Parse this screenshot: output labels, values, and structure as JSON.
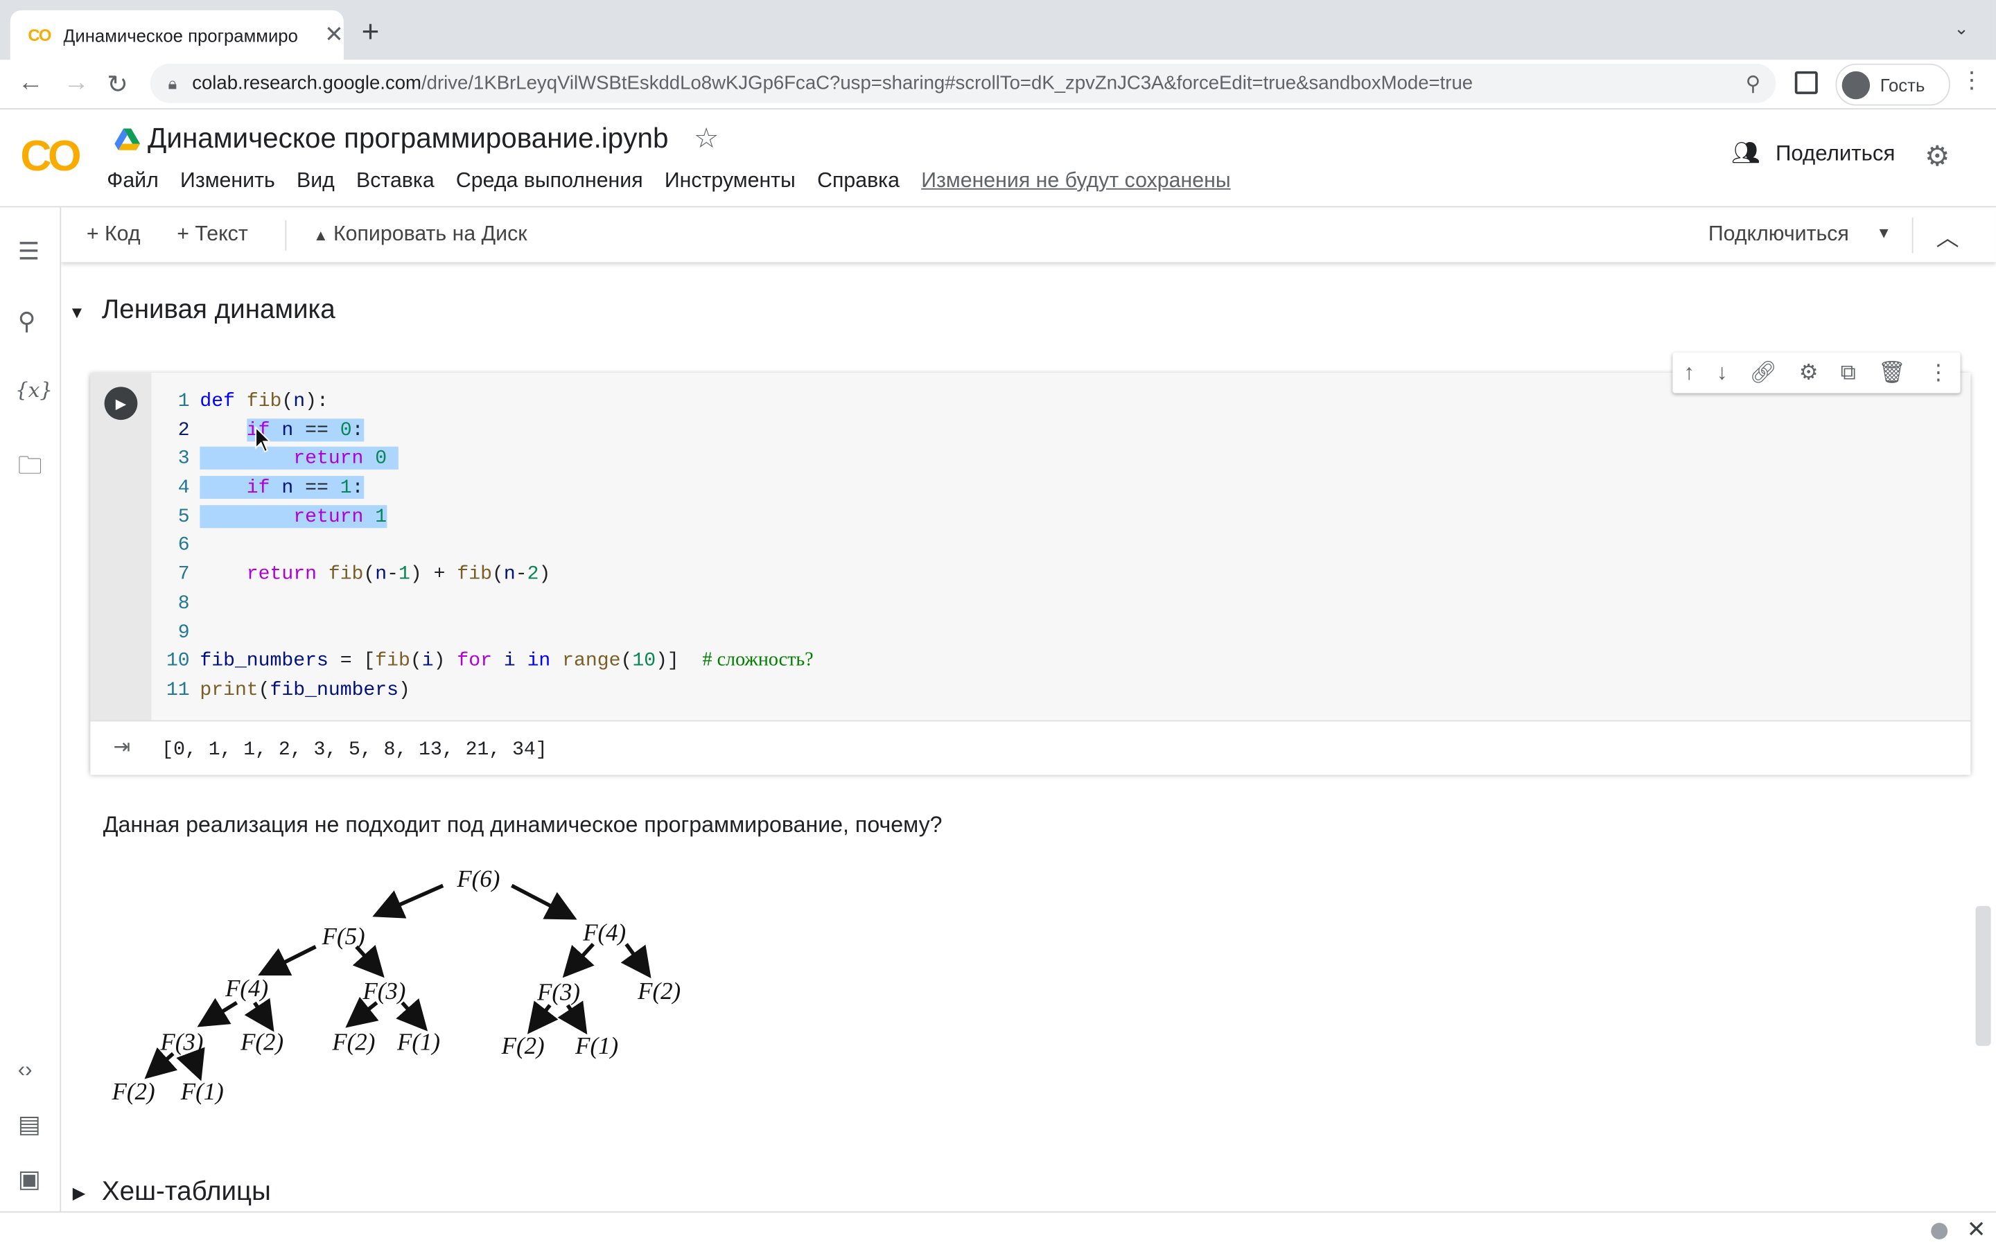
{
  "browser": {
    "tab_title": "Динамическое программиро",
    "tab_icon": "CO",
    "url_host": "colab.research.google.com",
    "url_path": "/drive/1KBrLeyqVilWSBtEskddLo8wKJGp6FcaC?usp=sharing#scrollTo=dK_zpvZnJC3A&forceEdit=true&sandboxMode=true",
    "profile_label": "Гость"
  },
  "colab": {
    "logo": "CO",
    "notebook_title": "Динамическое программирование.ipynb",
    "menu": [
      "Файл",
      "Изменить",
      "Вид",
      "Вставка",
      "Среда выполнения",
      "Инструменты",
      "Справка"
    ],
    "unsaved_notice": "Изменения не будут сохранены",
    "share_label": "Поделиться",
    "toolbar": {
      "add_code": "+ Код",
      "add_text": "+ Текст",
      "copy_to_drive": "Копировать на Диск",
      "connect": "Подключиться"
    }
  },
  "section": {
    "title": "Ленивая динамика",
    "next_title": "Хеш-таблицы"
  },
  "code_cell": {
    "line_numbers": [
      "1",
      "2",
      "3",
      "4",
      "5",
      "6",
      "7",
      "8",
      "9",
      "10",
      "11"
    ],
    "output": "[0, 1, 1, 2, 3, 5, 8, 13, 21, 34]"
  },
  "text_cell": {
    "paragraph": "Данная реализация не подходит под динамическое программирование, почему?",
    "tree_nodes": [
      "F(6)",
      "F(5)",
      "F(4)",
      "F(4)",
      "F(3)",
      "F(3)",
      "F(2)",
      "F(3)",
      "F(2)",
      "F(2)",
      "F(1)",
      "F(2)",
      "F(1)",
      "F(2)",
      "F(1)"
    ]
  },
  "colors": {
    "accent_orange": "#f9ab00",
    "selection": "#add6ff",
    "keyword_blue": "#0000ff",
    "control_purple": "#af00db",
    "number_green": "#098658"
  }
}
